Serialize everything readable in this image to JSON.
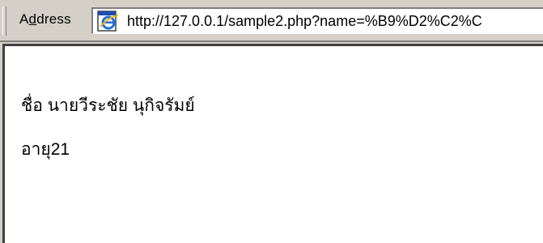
{
  "address_bar": {
    "label": "Address",
    "url": "http://127.0.0.1/sample2.php?name=%B9%D2%C2%C"
  },
  "page": {
    "name_line": "ชื่อ นายวีระชัย นุกิจรัมย์",
    "age_line": "อายุ21"
  }
}
